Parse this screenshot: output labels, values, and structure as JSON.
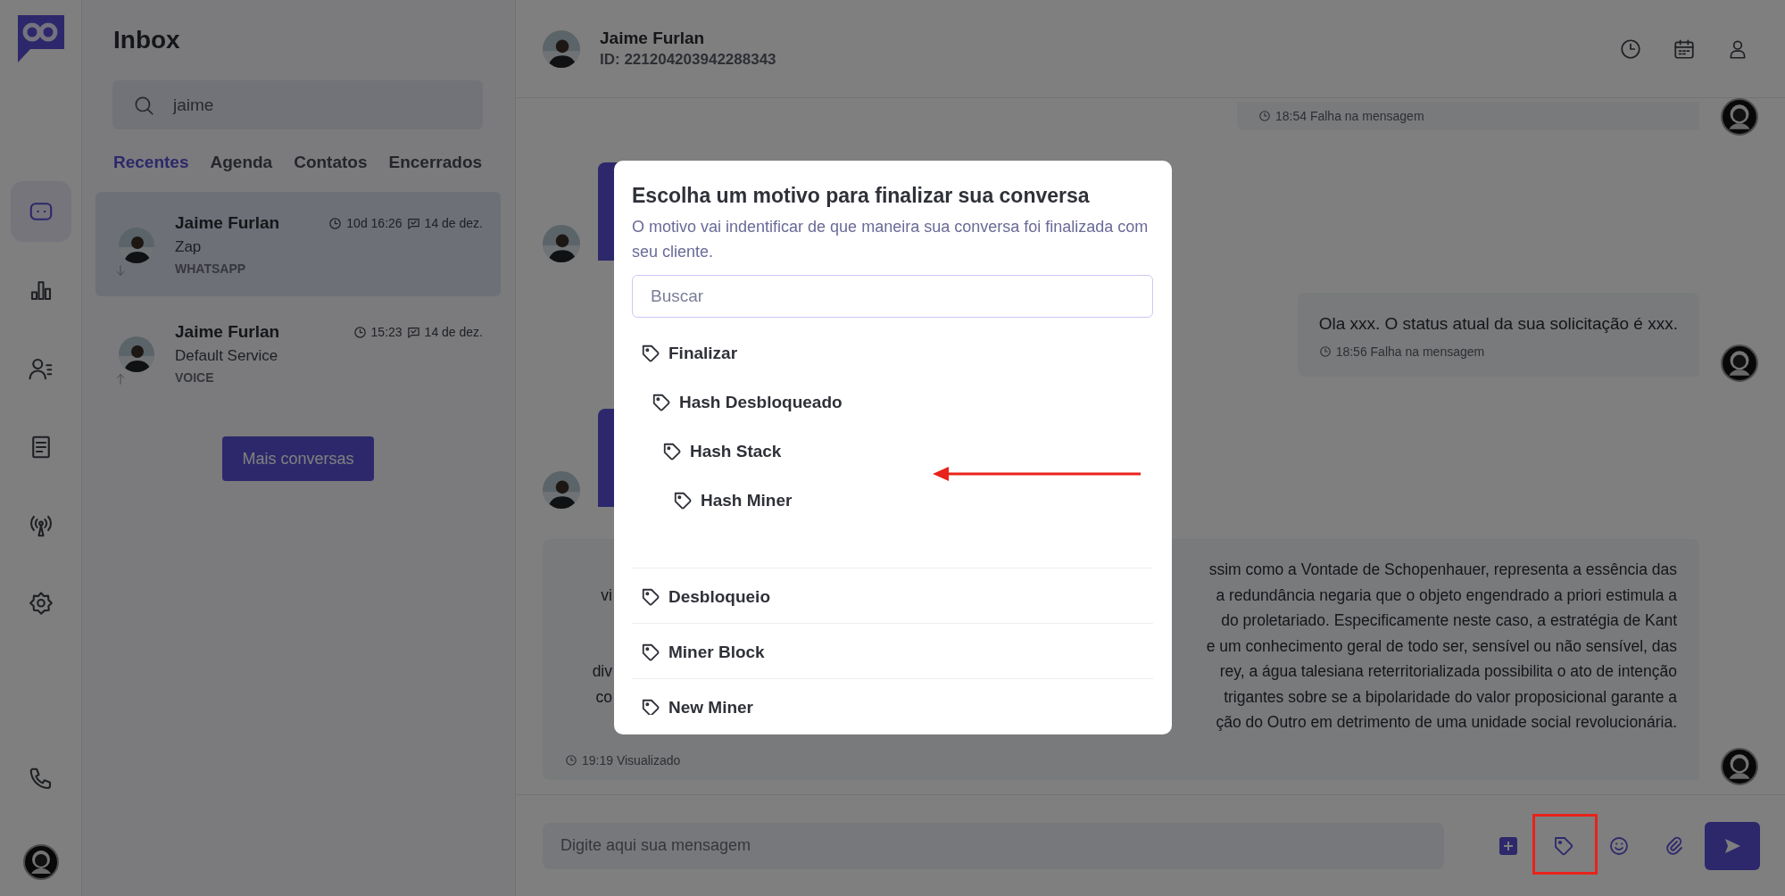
{
  "rail": {
    "items": [
      {
        "kind": "chat",
        "selected": true
      },
      {
        "kind": "chart",
        "selected": false
      },
      {
        "kind": "contacts",
        "selected": false
      },
      {
        "kind": "document",
        "selected": false
      },
      {
        "kind": "antenna",
        "selected": false
      },
      {
        "kind": "settings",
        "selected": false
      }
    ],
    "bottom_items": [
      {
        "kind": "phone",
        "selected": false
      }
    ]
  },
  "inbox": {
    "title": "Inbox",
    "search": {
      "value": "jaime"
    },
    "tabs": [
      {
        "label": "Recentes",
        "selected": true
      },
      {
        "label": "Agenda",
        "selected": false
      },
      {
        "label": "Contatos",
        "selected": false
      },
      {
        "label": "Encerrados",
        "selected": false
      }
    ],
    "conversations": [
      {
        "name": "Jaime Furlan",
        "time": "10d 16:26",
        "date": "14 de dez.",
        "subject": "Zap",
        "channel": "WHATSAPP",
        "kind": "incoming",
        "selected": true
      },
      {
        "name": "Jaime Furlan",
        "time": "15:23",
        "date": "14 de dez.",
        "subject": "Default Service",
        "channel": "VOICE",
        "kind": "outgoing",
        "selected": false
      }
    ],
    "more_button": "Mais conversas"
  },
  "chat": {
    "contact": {
      "name": "Jaime Furlan",
      "id": "ID: 221204203942288343"
    },
    "messages": [
      {
        "kind": "outgoing",
        "status": "18:54 Falha na mensagem"
      },
      {
        "kind": "incoming"
      },
      {
        "kind": "outgoing",
        "text": "Ola xxx. O status atual da sua solicitação é xxx.",
        "status": "18:56 Falha na mensagem"
      },
      {
        "kind": "incoming"
      },
      {
        "kind": "outgoing",
        "lines": [
          {
            "right": "ssim como a Vontade de Schopenhauer, representa a essência das"
          },
          {
            "left": "vi",
            "right": "a redundância negaria que o objeto engendrado a priori estimula a"
          },
          {
            "right": "do proletariado. Especificamente neste caso, a estratégia de Kant"
          },
          {
            "right": "e um conhecimento geral de todo ser, sensível ou não sensível, das"
          },
          {
            "left": "div",
            "right": "rey, a água talesiana reterritorializada possibilita o ato de intenção"
          },
          {
            "left": "co",
            "right": "trigantes sobre se a bipolaridade do valor proposicional garante a"
          },
          {
            "right": "ção do Outro em detrimento de uma unidade social revolucionária."
          }
        ],
        "status": "19:19 Visualizado"
      }
    ],
    "composer": {
      "placeholder": "Digite aqui sua mensagem"
    }
  },
  "modal": {
    "title": "Escolha um motivo para finalizar sua conversa",
    "subtitle": "O motivo vai indentificar de que maneira sua conversa foi finalizada com seu cliente.",
    "search": {
      "placeholder": "Buscar"
    },
    "reasons": [
      {
        "label": "Finalizar",
        "children": [
          {
            "label": "Hash Desbloqueado",
            "children": [
              {
                "label": "Hash Stack",
                "children": [
                  {
                    "label": "Hash Miner"
                  }
                ]
              }
            ]
          }
        ]
      },
      {
        "label": "Desbloqueio"
      },
      {
        "label": "Miner Block"
      },
      {
        "label": "New Miner"
      }
    ]
  }
}
